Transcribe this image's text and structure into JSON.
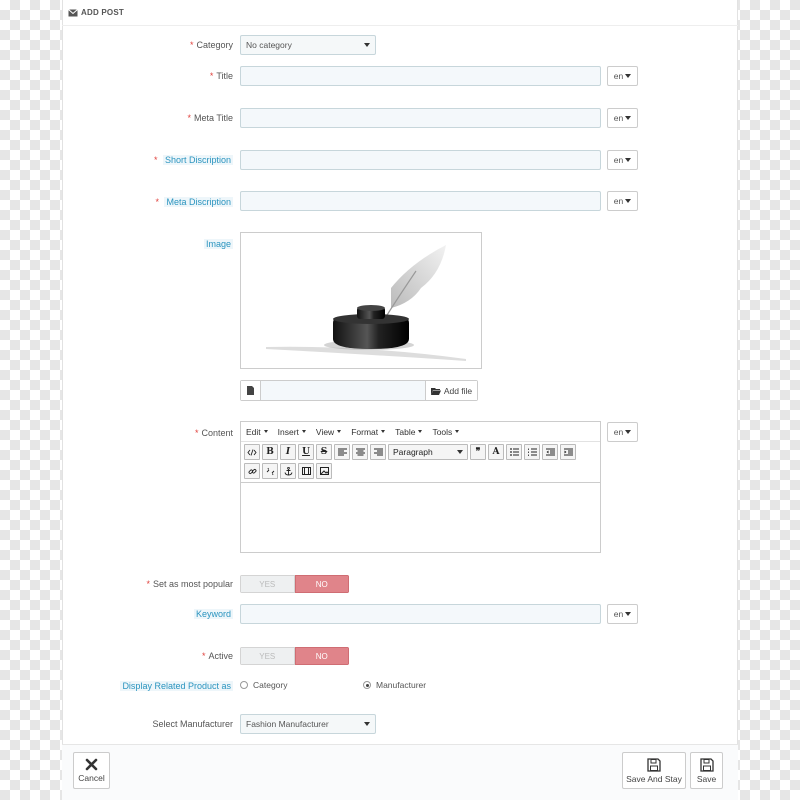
{
  "header": {
    "title": "ADD POST",
    "icon": "envelope-icon"
  },
  "form": {
    "category": {
      "label": "Category",
      "value": "No category"
    },
    "title": {
      "label": "Title",
      "lang": "en"
    },
    "meta_title": {
      "label": "Meta Title",
      "lang": "en"
    },
    "short_description": {
      "label": "Short Discription",
      "lang": "en"
    },
    "meta_description": {
      "label": "Meta Discription",
      "lang": "en"
    },
    "image": {
      "label": "Image",
      "add_file_label": "Add file"
    },
    "content": {
      "label": "Content",
      "lang": "en",
      "menus": [
        "Edit",
        "Insert",
        "View",
        "Format",
        "Table",
        "Tools"
      ],
      "format_select": "Paragraph",
      "toolbar_glyphs": {
        "bold": "B",
        "italic": "I",
        "underline": "U",
        "strike": "S",
        "blockquote": "❞",
        "font_color": "A"
      }
    },
    "most_popular": {
      "label": "Set as most popular",
      "yes": "YES",
      "no": "NO"
    },
    "keyword": {
      "label": "Keyword",
      "lang": "en"
    },
    "active": {
      "label": "Active",
      "yes": "YES",
      "no": "NO"
    },
    "related": {
      "label": "Display Related Product as",
      "option_category": "Category",
      "option_manufacturer": "Manufacturer",
      "selected": "Manufacturer"
    },
    "manufacturer": {
      "label": "Select Manufacturer",
      "value": "Fashion Manufacturer"
    }
  },
  "footer": {
    "cancel": "Cancel",
    "save_and_stay": "Save And Stay",
    "save": "Save"
  },
  "colors": {
    "required": "#e0413d",
    "tooltip": "#2a94bf",
    "toggle_no": "#e0848a"
  }
}
